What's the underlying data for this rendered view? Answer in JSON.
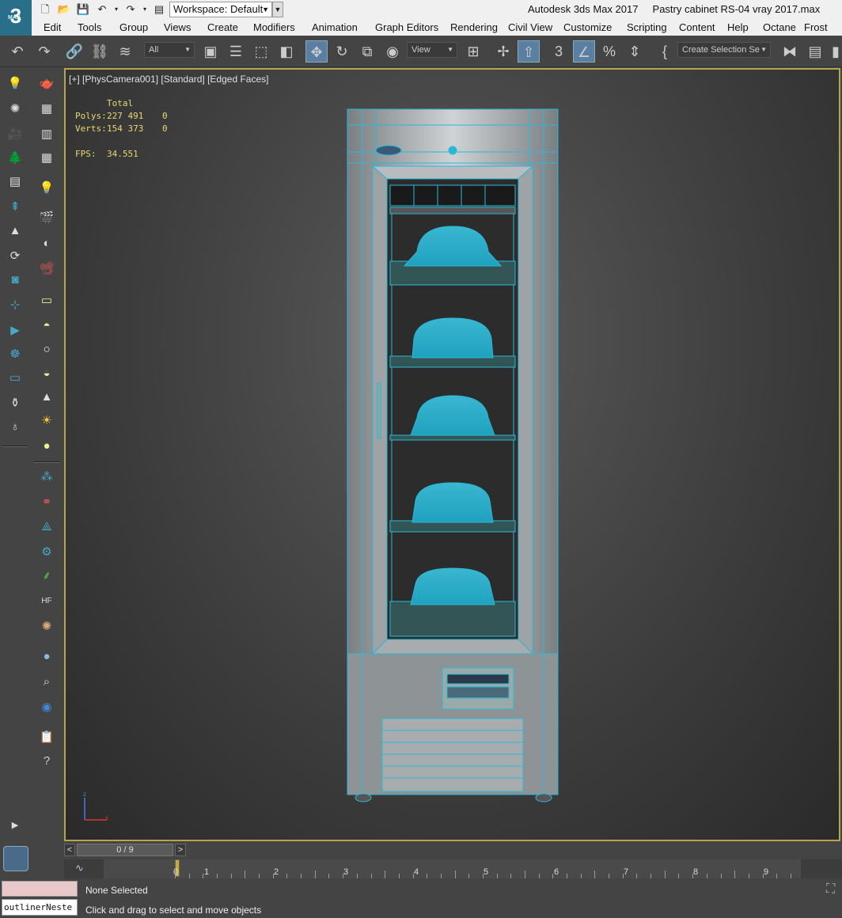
{
  "titlebar": {
    "logo_text": "3",
    "logo_sub": "MAX",
    "workspace_label": "Workspace: Default",
    "app_title": "Autodesk 3ds Max 2017     Pastry cabinet RS-04 vray 2017.max"
  },
  "menu": [
    "Edit",
    "Tools",
    "Group",
    "Views",
    "Create",
    "Modifiers",
    "Animation",
    "Graph Editors",
    "Rendering",
    "Civil View",
    "Customize",
    "Scripting",
    "Content",
    "Help",
    "Octane",
    "Frost"
  ],
  "toolbar": {
    "selection_filter": "All",
    "ref_coord": "View",
    "selection_set": "Create Selection Se"
  },
  "viewport": {
    "label": "[+] [PhysCamera001] [Standard] [Edged Faces]",
    "stats": {
      "header": "Total",
      "polys_label": "Polys:",
      "polys_total": "227 491",
      "polys_sel": "0",
      "verts_label": "Verts:",
      "verts_total": "154 373",
      "verts_sel": "0",
      "fps_label": "FPS:",
      "fps_value": "34.551"
    },
    "axis": {
      "z": "z",
      "x": "x"
    },
    "wire_color": "#2ab8d8"
  },
  "timeline": {
    "slider_text": "0 / 9",
    "prev": "<",
    "next": ">",
    "ticks": [
      "0",
      "1",
      "2",
      "3",
      "4",
      "5",
      "6",
      "7",
      "8",
      "9"
    ]
  },
  "status": {
    "maxscript_text": "outlinerNeste",
    "selection": "None Selected",
    "prompt": "Click and drag to select and move objects"
  },
  "colors": {
    "accent": "#5a7fa3",
    "viewport_border": "#b8a54a",
    "stats_text": "#e8d870"
  }
}
